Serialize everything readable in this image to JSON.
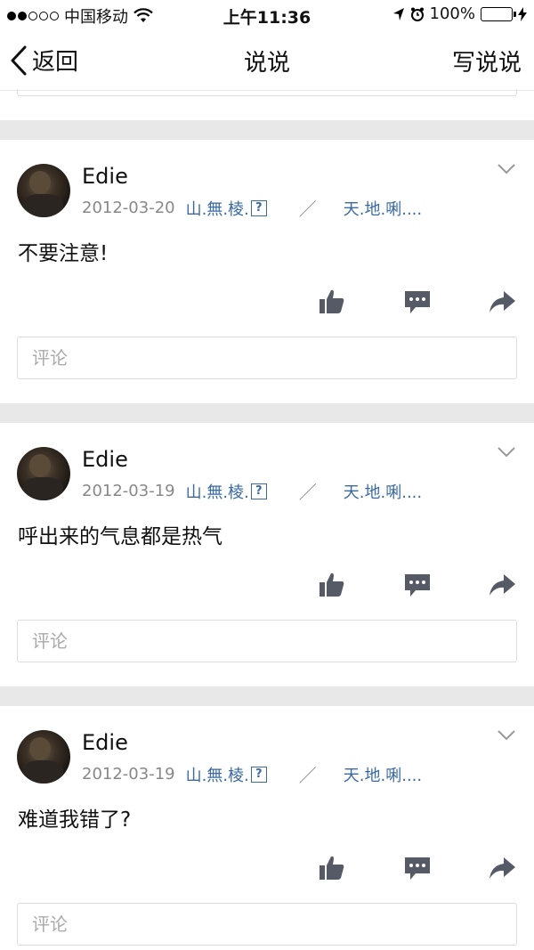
{
  "status_bar": {
    "carrier": "中国移动",
    "time": "上午11:36",
    "battery": "100%"
  },
  "nav": {
    "back_label": "返回",
    "title": "说说",
    "action_label": "写说说"
  },
  "posts": [
    {
      "author": "Edie",
      "date": "2012-03-20",
      "source": "山.無.棱.",
      "source_badge": "?",
      "slash": "／",
      "target": "天.地.唎....",
      "content": "不要注意!",
      "comment_placeholder": "评论"
    },
    {
      "author": "Edie",
      "date": "2012-03-19",
      "source": "山.無.棱.",
      "source_badge": "?",
      "slash": "／",
      "target": "天.地.唎....",
      "content": "呼出来的气息都是热气",
      "comment_placeholder": "评论"
    },
    {
      "author": "Edie",
      "date": "2012-03-19",
      "source": "山.無.棱.",
      "source_badge": "?",
      "slash": "／",
      "target": "天.地.唎....",
      "content": "难道我错了?",
      "comment_placeholder": "评论"
    }
  ],
  "colors": {
    "link": "#3a6aa6",
    "separator": "#e8e8e8",
    "icon": "#555a66",
    "battery": "#35c759"
  }
}
